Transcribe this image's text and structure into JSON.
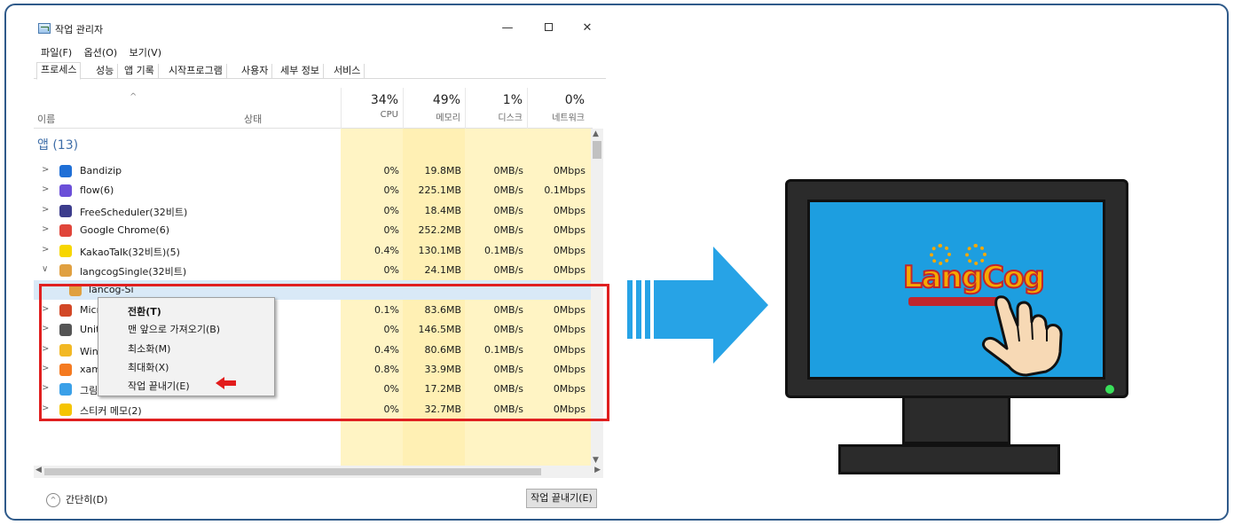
{
  "window": {
    "title": "작업 관리자",
    "minimize": "—",
    "close": "✕"
  },
  "menu": [
    "파일(F)",
    "옵션(O)",
    "보기(V)"
  ],
  "tabs": [
    "프로세스",
    "성능",
    "앱 기록",
    "시작프로그램",
    "사용자",
    "세부 정보",
    "서비스"
  ],
  "columns": {
    "name": "이름",
    "status": "상태",
    "cpu": {
      "pct": "34%",
      "label": "CPU"
    },
    "memory": {
      "pct": "49%",
      "label": "메모리"
    },
    "disk": {
      "pct": "1%",
      "label": "디스크"
    },
    "network": {
      "pct": "0%",
      "label": "네트워크"
    }
  },
  "group_label": "앱 (13)",
  "rows": [
    {
      "name": "Bandizip",
      "cpu": "0%",
      "mem": "19.8MB",
      "disk": "0MB/s",
      "net": "0Mbps",
      "icon": "bandizip-icon",
      "color": "#1f6fd6"
    },
    {
      "name": "flow(6)",
      "cpu": "0%",
      "mem": "225.1MB",
      "disk": "0MB/s",
      "net": "0.1Mbps",
      "icon": "flow-icon",
      "color": "#6b4fd8"
    },
    {
      "name": "FreeScheduler(32비트)",
      "cpu": "0%",
      "mem": "18.4MB",
      "disk": "0MB/s",
      "net": "0Mbps",
      "icon": "calendar-icon",
      "color": "#3c3c8c"
    },
    {
      "name": "Google Chrome(6)",
      "cpu": "0%",
      "mem": "252.2MB",
      "disk": "0MB/s",
      "net": "0Mbps",
      "icon": "chrome-icon",
      "color": "#e0453a"
    },
    {
      "name": "KakaoTalk(32비트)(5)",
      "cpu": "0.4%",
      "mem": "130.1MB",
      "disk": "0.1MB/s",
      "net": "0Mbps",
      "icon": "kakaotalk-icon",
      "color": "#f7d600"
    },
    {
      "name": "langcogSingle(32비트)",
      "cpu": "0%",
      "mem": "24.1MB",
      "disk": "0MB/s",
      "net": "0Mbps",
      "icon": "langcog-icon",
      "color": "#e0a040",
      "expanded": true
    },
    {
      "name": "lancog-Si",
      "cpu": "",
      "mem": "",
      "disk": "",
      "net": "",
      "icon": "langcog-icon",
      "color": "#e0a040",
      "child": true
    },
    {
      "name": "Microsoft P",
      "cpu": "0.1%",
      "mem": "83.6MB",
      "disk": "0MB/s",
      "net": "0Mbps",
      "icon": "powerpoint-icon",
      "color": "#d24726"
    },
    {
      "name": "Unity Hub(",
      "cpu": "0%",
      "mem": "146.5MB",
      "disk": "0MB/s",
      "net": "0Mbps",
      "icon": "unity-icon",
      "color": "#555555"
    },
    {
      "name": "Windows 탐",
      "cpu": "0.4%",
      "mem": "80.6MB",
      "disk": "0.1MB/s",
      "net": "0Mbps",
      "icon": "folder-icon",
      "color": "#f2b824"
    },
    {
      "name": "xampp-con",
      "cpu": "0.8%",
      "mem": "33.9MB",
      "disk": "0MB/s",
      "net": "0Mbps",
      "icon": "xampp-icon",
      "color": "#f47a20"
    },
    {
      "name": "그림판",
      "cpu": "0%",
      "mem": "17.2MB",
      "disk": "0MB/s",
      "net": "0Mbps",
      "icon": "paint-icon",
      "color": "#3aa0e8"
    },
    {
      "name": "스티커 메모(2)",
      "cpu": "0%",
      "mem": "32.7MB",
      "disk": "0MB/s",
      "net": "0Mbps",
      "icon": "sticky-notes-icon",
      "color": "#f5c400"
    }
  ],
  "context_menu": [
    "전환(T)",
    "맨 앞으로 가져오기(B)",
    "최소화(M)",
    "최대화(X)",
    "작업 끝내기(E)"
  ],
  "footer": {
    "fewer_details": "간단히(D)",
    "end_task": "작업 끝내기(E)"
  },
  "monitor": {
    "logo_text": "LangCog"
  },
  "colors": {
    "highlight": "#e02020",
    "arrow": "#27a3e6",
    "screen": "#1d9ee0",
    "power_led": "#39e05a"
  }
}
